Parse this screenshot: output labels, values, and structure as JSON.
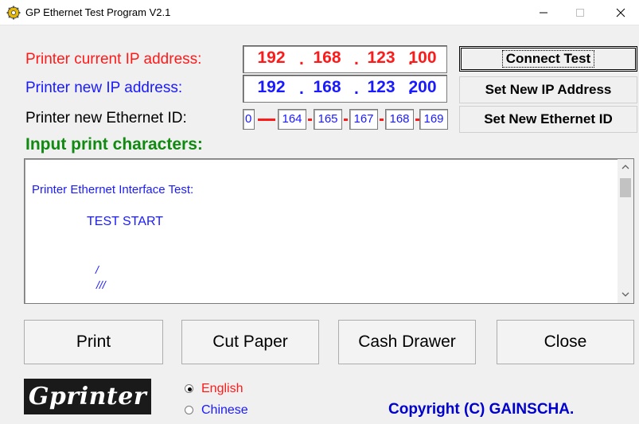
{
  "window": {
    "title": "GP Ethernet Test Program  V2.1",
    "minimize_glyph": "—",
    "maximize_glyph": "☐",
    "close_glyph": "✕"
  },
  "labels": {
    "current_ip": "Printer current IP address:",
    "new_ip": "Printer new IP address:",
    "new_eth": "Printer new Ethernet ID:",
    "input_chars": "Input print characters:"
  },
  "current_ip": [
    "192",
    "168",
    "123",
    "100"
  ],
  "new_ip": [
    "192",
    "168",
    "123",
    "200"
  ],
  "ethernet_id": [
    "0",
    "164",
    "165",
    "167",
    "168",
    "169"
  ],
  "buttons": {
    "connect": "Connect Test",
    "set_ip": "Set New IP Address",
    "set_eth": "Set New Ethernet ID",
    "print": "Print",
    "cut": "Cut Paper",
    "cash": "Cash Drawer",
    "close": "Close"
  },
  "textarea": {
    "line1": "Printer Ethernet Interface Test:",
    "line2": "TEST  START",
    "line3": "/",
    "line4": "///"
  },
  "language": {
    "english": "English",
    "chinese": "Chinese",
    "selected": "English"
  },
  "logo_text": "Gprinter",
  "copyright": "Copyright (C) GAINSCHA.",
  "colors": {
    "red": "#ff1a1a",
    "blue": "#1a1aff",
    "green": "#118a11",
    "dark_blue": "#0000cc"
  }
}
